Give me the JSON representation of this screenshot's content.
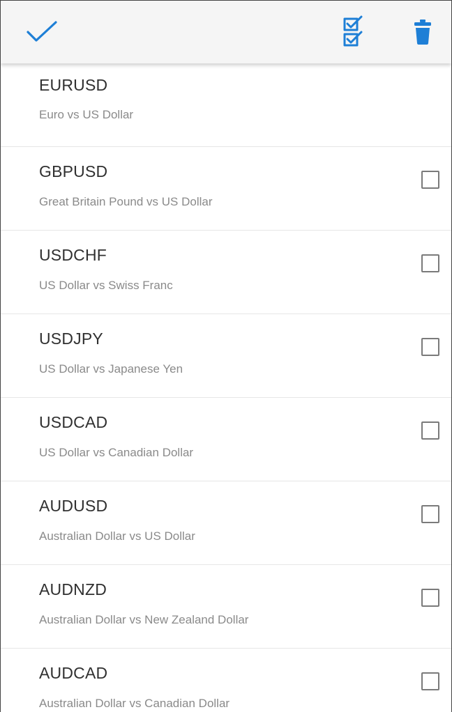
{
  "colors": {
    "accent": "#1e7fd6",
    "toolbar_bg": "#f5f5f5",
    "title_text": "#303030",
    "subtitle_text": "#8a8a8a"
  },
  "toolbar": {
    "done_icon": "checkmark-icon",
    "select_all_icon": "select-all-icon",
    "delete_icon": "trash-icon"
  },
  "pairs": [
    {
      "symbol": "EURUSD",
      "description": "Euro vs US Dollar",
      "has_checkbox": false,
      "checked": false
    },
    {
      "symbol": "GBPUSD",
      "description": "Great Britain Pound vs US Dollar",
      "has_checkbox": true,
      "checked": false
    },
    {
      "symbol": "USDCHF",
      "description": "US Dollar vs Swiss Franc",
      "has_checkbox": true,
      "checked": false
    },
    {
      "symbol": "USDJPY",
      "description": "US Dollar vs Japanese Yen",
      "has_checkbox": true,
      "checked": false
    },
    {
      "symbol": "USDCAD",
      "description": "US Dollar vs Canadian Dollar",
      "has_checkbox": true,
      "checked": false
    },
    {
      "symbol": "AUDUSD",
      "description": "Australian Dollar vs US Dollar",
      "has_checkbox": true,
      "checked": false
    },
    {
      "symbol": "AUDNZD",
      "description": "Australian Dollar vs New Zealand Dollar",
      "has_checkbox": true,
      "checked": false
    },
    {
      "symbol": "AUDCAD",
      "description": "Australian Dollar vs Canadian Dollar",
      "has_checkbox": true,
      "checked": false
    }
  ]
}
